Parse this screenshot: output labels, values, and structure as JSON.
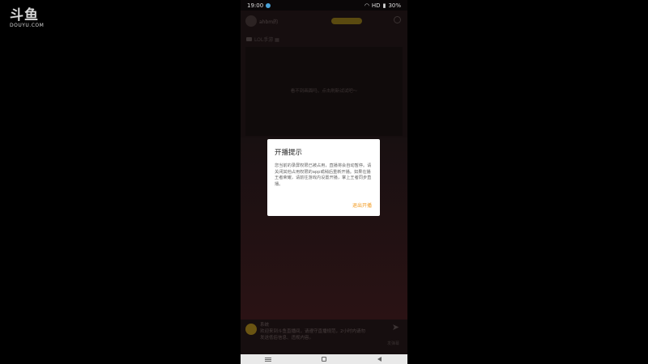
{
  "watermark": {
    "main": "斗鱼",
    "sub": "DOUYU.COM"
  },
  "statusbar": {
    "time": "19:00",
    "battery": "30%",
    "network": "HD"
  },
  "header": {
    "room_name": "ahbm的",
    "badge": ""
  },
  "sub_header": {
    "label": "LOL手游 ▦"
  },
  "preview": {
    "message": "看不到画面吗，点击刷新试试吧～"
  },
  "chat": {
    "sender": "系统",
    "message": "欢迎来到斗鱼直播间，请遵守直播规范，2小时内请勿发送低俗信息、违规内容。",
    "right_text": "发弹幕"
  },
  "dialog": {
    "title": "开播提示",
    "body": "您当前的录屏权限已被占用，直播将会自动暂停。请关闭其他占用权限的app或稍后重新开播。如果在播王者荣耀，请前往游戏内设置开播，掌上王者同步直播。",
    "button": "退出开播"
  },
  "colors": {
    "accent": "#f29a1f",
    "dialog_bg": "#ffffff",
    "page_bg": "#000000"
  }
}
